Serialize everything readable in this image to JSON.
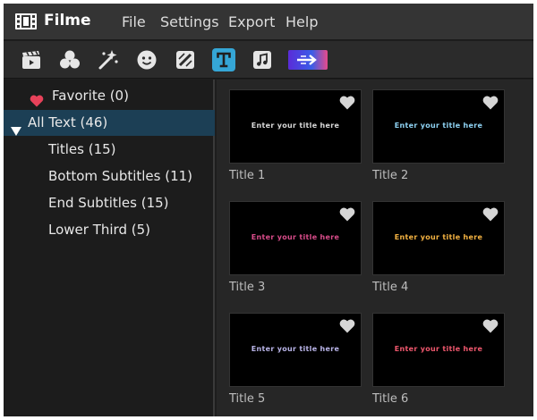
{
  "app": {
    "name": "Filme",
    "menu": {
      "file": "File",
      "settings": "Settings",
      "export": "Export",
      "help": "Help"
    }
  },
  "toolbar": {
    "icons": [
      "media-icon",
      "effects-icon",
      "transitions-icon",
      "stickers-icon",
      "filters-icon",
      "text-icon",
      "music-icon",
      "promo-icon"
    ],
    "active": "text-icon"
  },
  "sidebar": {
    "favorite": "Favorite (0)",
    "all_text": "All Text (46)",
    "items": [
      {
        "label": "Titles (15)"
      },
      {
        "label": "Bottom Subtitles (11)"
      },
      {
        "label": "End Subtitles (15)"
      },
      {
        "label": "Lower Third (5)"
      }
    ]
  },
  "grid": {
    "cards": [
      {
        "label": "Title 1",
        "preview": "Enter your title here",
        "preview_color": "#d8d8d8"
      },
      {
        "label": "Title 2",
        "preview": "Enter your title here",
        "preview_color": "#8fd3f4"
      },
      {
        "label": "Title 3",
        "preview": "Enter your title here",
        "preview_color": "#d94c8a"
      },
      {
        "label": "Title 4",
        "preview": "Enter your title here",
        "preview_color": "#f5b342"
      },
      {
        "label": "Title 5",
        "preview": "Enter your title here",
        "preview_color": "#b9b4e8"
      },
      {
        "label": "Title 6",
        "preview": "Enter your title here",
        "preview_color": "#f0586e"
      }
    ]
  },
  "colors": {
    "accent": "#35a6d6",
    "selection": "#1c3f55",
    "favorite": "#e8425a"
  }
}
